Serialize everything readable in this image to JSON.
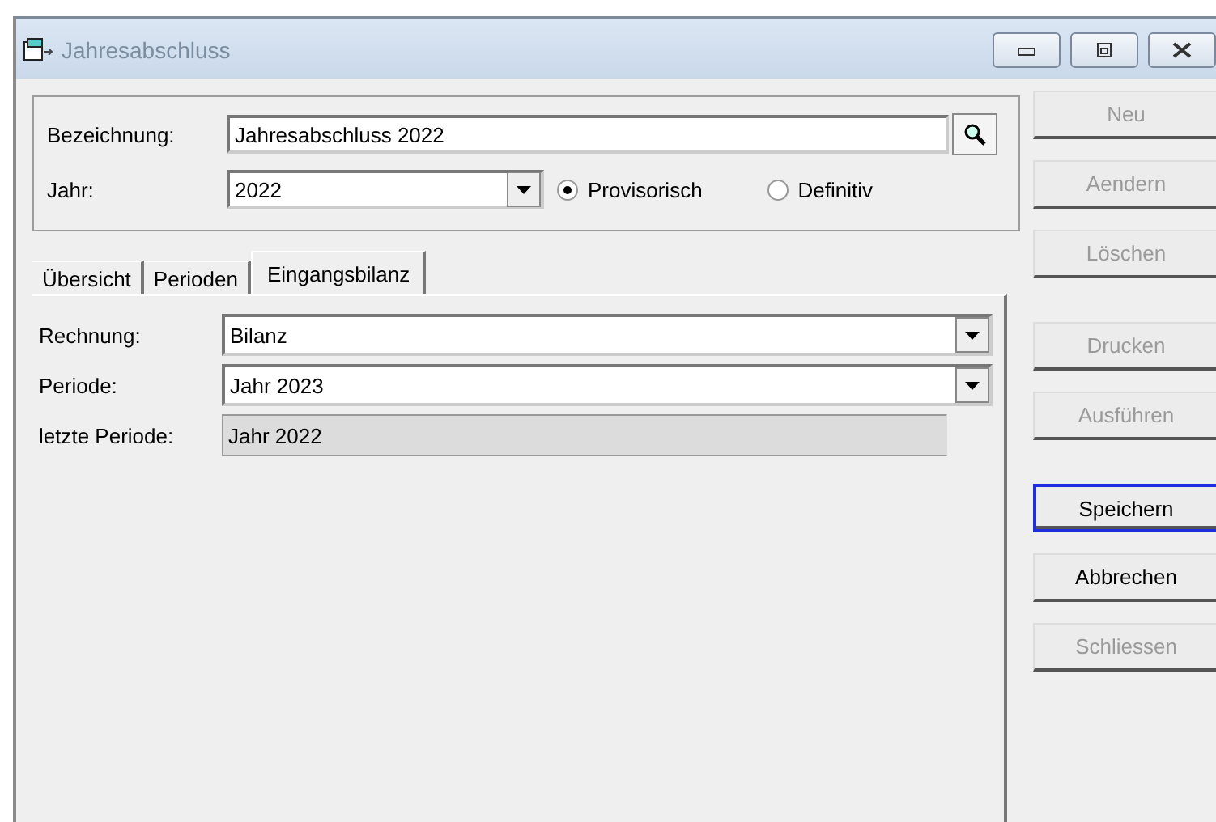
{
  "window": {
    "title": "Jahresabschluss"
  },
  "header": {
    "bezeichnung_label": "Bezeichnung:",
    "bezeichnung_value": "Jahresabschluss 2022",
    "jahr_label": "Jahr:",
    "jahr_value": "2022",
    "radios": [
      {
        "label": "Provisorisch",
        "selected": true
      },
      {
        "label": "Definitiv",
        "selected": false
      }
    ]
  },
  "tabs": [
    {
      "label": "Übersicht",
      "selected": false
    },
    {
      "label": "Perioden",
      "selected": false
    },
    {
      "label": "Eingangsbilanz",
      "selected": true
    }
  ],
  "fields": [
    {
      "label": "Rechnung:",
      "value": "Bilanz",
      "kind": "dropdown"
    },
    {
      "label": "Periode:",
      "value": "Jahr 2023",
      "kind": "dropdown"
    },
    {
      "label": "letzte Periode:",
      "value": "Jahr 2022",
      "kind": "readonly"
    }
  ],
  "button_groups": [
    [
      {
        "label": "Neu",
        "disabled": true,
        "focused": false
      },
      {
        "label": "Aendern",
        "disabled": true,
        "focused": false
      },
      {
        "label": "Löschen",
        "disabled": true,
        "focused": false
      }
    ],
    [
      {
        "label": "Drucken",
        "disabled": true,
        "focused": false
      },
      {
        "label": "Ausführen",
        "disabled": true,
        "focused": false
      }
    ],
    [
      {
        "label": "Speichern",
        "disabled": false,
        "focused": true
      },
      {
        "label": "Abbrechen",
        "disabled": false,
        "focused": false
      },
      {
        "label": "Schliessen",
        "disabled": true,
        "focused": false
      }
    ]
  ]
}
